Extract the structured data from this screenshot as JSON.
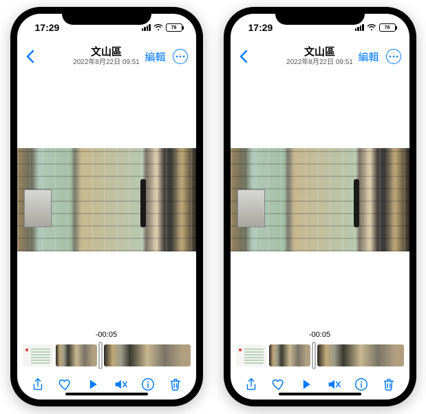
{
  "phones": [
    {
      "status": {
        "time": "17:29",
        "battery": "78"
      },
      "nav": {
        "title": "文山區",
        "subtitle": "2022年8月22日 09:51",
        "edit": "編輯"
      },
      "timecode": "-00:05"
    },
    {
      "status": {
        "time": "17:29",
        "battery": "78"
      },
      "nav": {
        "title": "文山區",
        "subtitle": "2022年8月22日 09:51",
        "edit": "編輯"
      },
      "timecode": "-00:05"
    }
  ]
}
